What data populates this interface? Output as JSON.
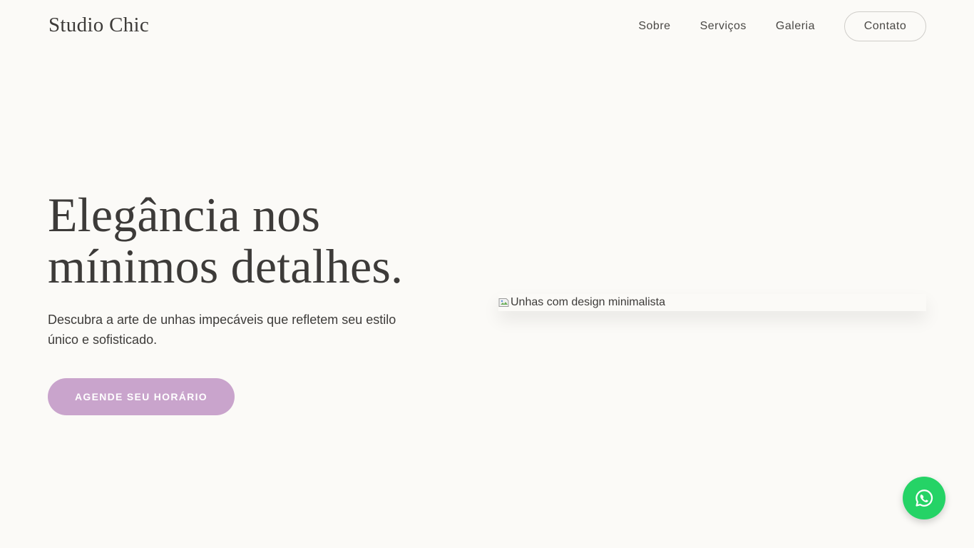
{
  "header": {
    "logo": "Studio Chic",
    "nav": {
      "about": "Sobre",
      "services": "Serviços",
      "gallery": "Galeria",
      "contact": "Contato"
    }
  },
  "hero": {
    "title_line1": "Elegância nos",
    "title_line2": "mínimos detalhes.",
    "description": "Descubra a arte de unhas impecáveis que refletem seu estilo único e sofisticado.",
    "cta_label": "AGENDE SEU HORÁRIO",
    "image_alt": "Unhas com design minimalista"
  },
  "whatsapp": {
    "icon": "whatsapp-icon"
  },
  "colors": {
    "background": "#fbfaf7",
    "accent": "#c9a4cc",
    "whatsapp": "#25d366",
    "text": "#3d3b39"
  }
}
